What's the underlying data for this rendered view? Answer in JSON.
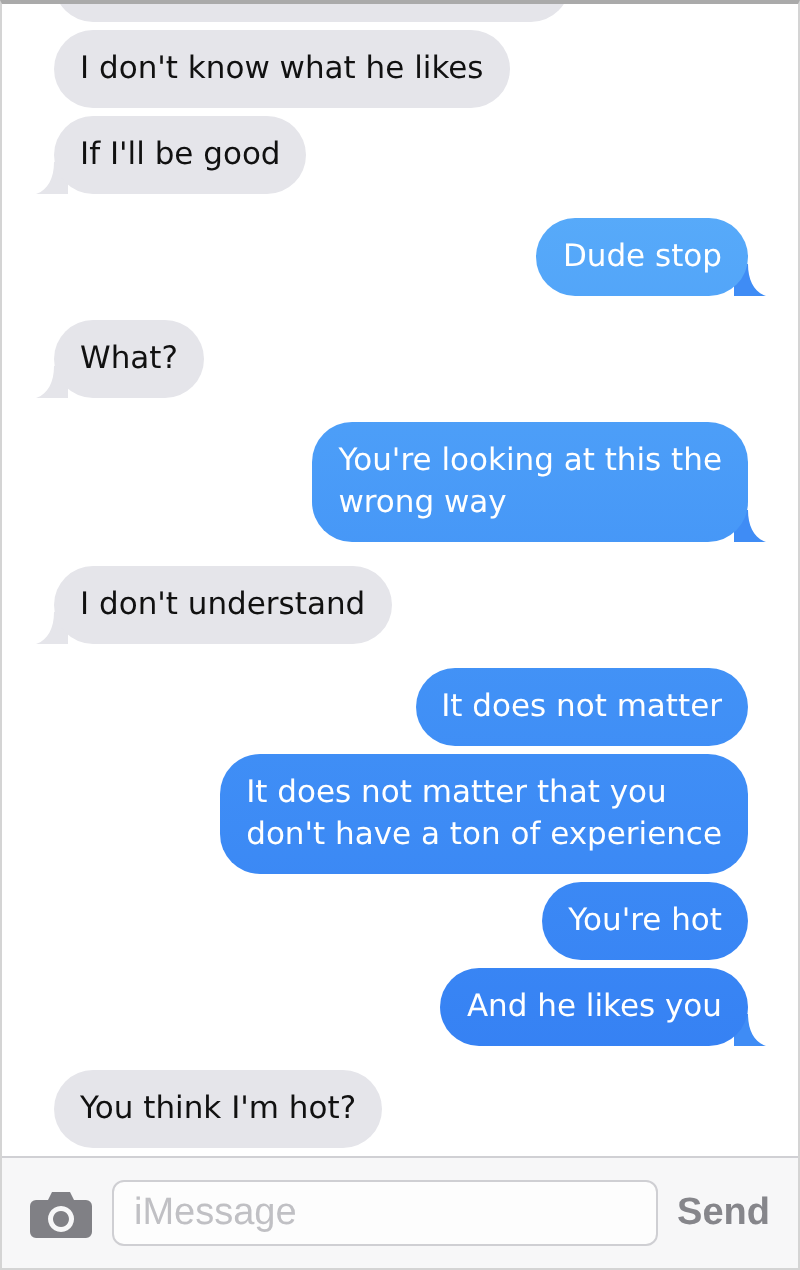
{
  "messages": [
    {
      "kind": "incoming",
      "text": "I don't know what he likes",
      "tail": false
    },
    {
      "kind": "incoming",
      "text": "If I'll be good",
      "tail": true
    },
    {
      "kind": "outgoing",
      "text": "Dude stop",
      "tail": true
    },
    {
      "kind": "incoming",
      "text": "What?",
      "tail": true
    },
    {
      "kind": "outgoing",
      "text": "You're looking at this the\nwrong way",
      "tail": true
    },
    {
      "kind": "incoming",
      "text": "I don't understand",
      "tail": true
    },
    {
      "kind": "outgoing",
      "text": "It does not matter",
      "tail": false
    },
    {
      "kind": "outgoing",
      "text": "It does not matter that you\ndon't have a ton of experience",
      "tail": false
    },
    {
      "kind": "outgoing",
      "text": "You're hot",
      "tail": false
    },
    {
      "kind": "outgoing",
      "text": "And he likes you",
      "tail": true
    },
    {
      "kind": "incoming",
      "text": "You think I'm hot?",
      "tail": false
    }
  ],
  "composer": {
    "placeholder": "iMessage",
    "send": "Send"
  }
}
